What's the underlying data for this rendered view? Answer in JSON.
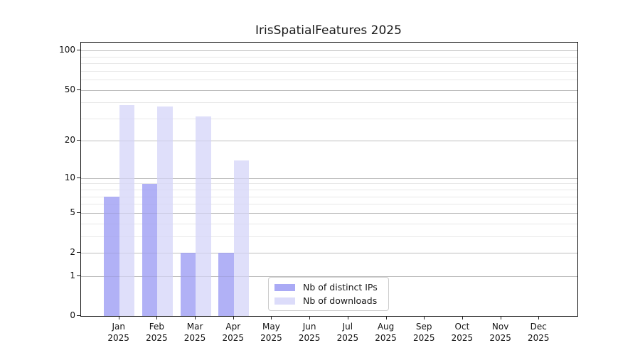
{
  "title": "IrisSpatialFeatures 2025",
  "chart_data": {
    "type": "bar",
    "title": "IrisSpatialFeatures 2025",
    "x_categories": [
      "Jan 2025",
      "Feb 2025",
      "Mar 2025",
      "Apr 2025",
      "May 2025",
      "Jun 2025",
      "Jul 2025",
      "Aug 2025",
      "Sep 2025",
      "Oct 2025",
      "Nov 2025",
      "Dec 2025"
    ],
    "series": [
      {
        "name": "Nb of distinct IPs",
        "color": "#aaaaf5",
        "values": [
          7,
          9,
          2,
          2,
          0,
          0,
          0,
          0,
          0,
          0,
          0,
          0
        ]
      },
      {
        "name": "Nb of downloads",
        "color": "#dcdcfa",
        "values": [
          38,
          37,
          31,
          14,
          0,
          0,
          0,
          0,
          0,
          0,
          0,
          0
        ]
      }
    ],
    "y_axis": {
      "scale": "log1p",
      "major_ticks": [
        0,
        1,
        2,
        5,
        10,
        20,
        50,
        100
      ],
      "minor_ticks": [
        3,
        4,
        6,
        7,
        8,
        9,
        30,
        40,
        60,
        70,
        80,
        90
      ],
      "range_top": 115
    },
    "legend": {
      "position": "lower center"
    },
    "grid": true,
    "colors": {
      "background": "#ffffff",
      "axis": "#111111",
      "grid_major": "#c9c9c9",
      "grid_minor": "#ededed"
    }
  }
}
